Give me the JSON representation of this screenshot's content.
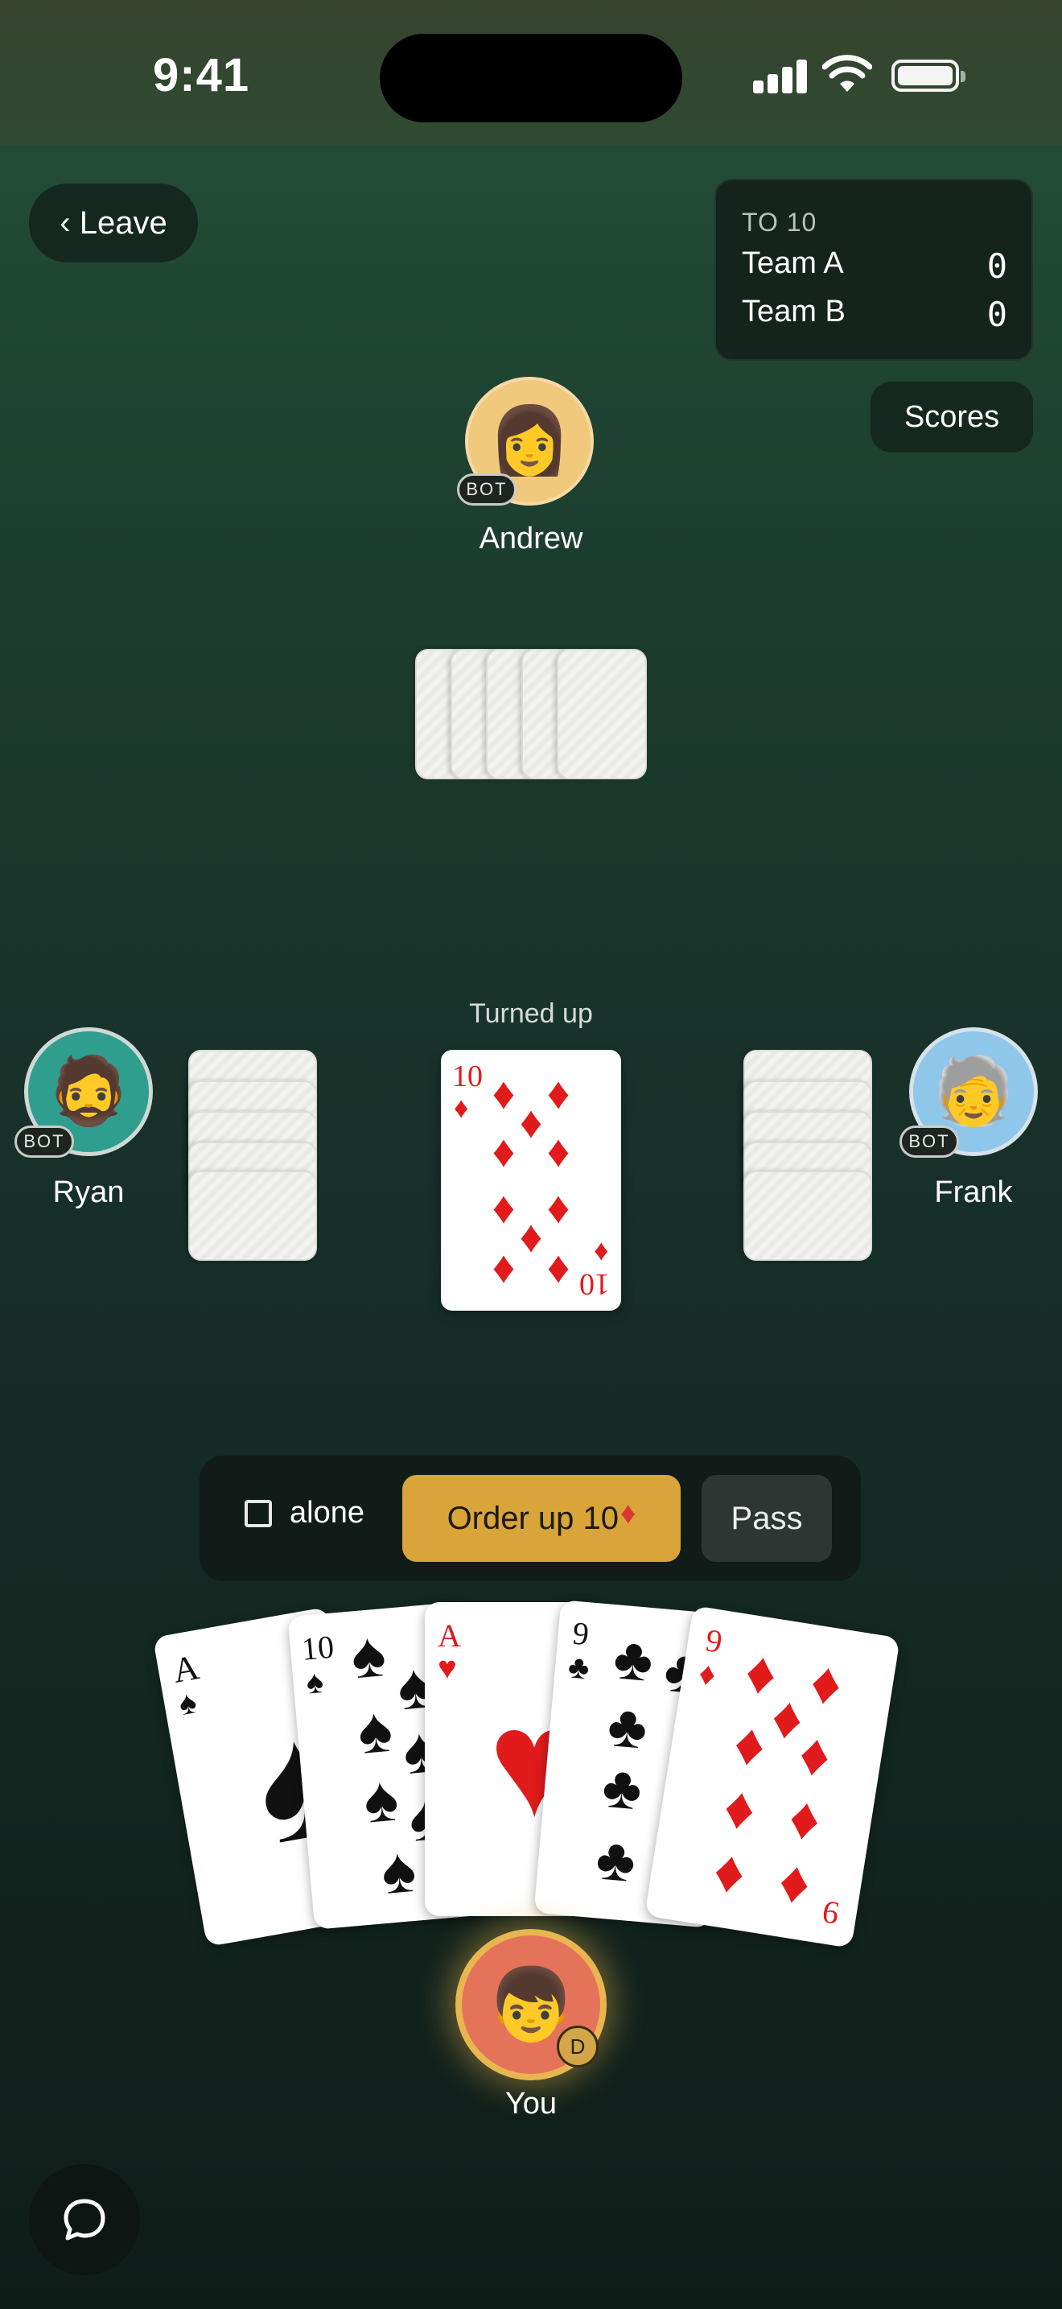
{
  "status_bar": {
    "time": "9:41"
  },
  "header": {
    "leave_label": "‹ Leave",
    "scores_label": "Scores"
  },
  "scoreboard": {
    "title": "TO 10",
    "teams": [
      {
        "name": "Team A",
        "score": "0"
      },
      {
        "name": "Team B",
        "score": "0"
      }
    ]
  },
  "players": {
    "north": {
      "name": "Andrew",
      "badge": "BOT",
      "avatar": "👩"
    },
    "west": {
      "name": "Ryan",
      "badge": "BOT",
      "avatar": "🧔"
    },
    "east": {
      "name": "Frank",
      "badge": "BOT",
      "avatar": "🧓"
    },
    "south": {
      "name": "You",
      "dealer_badge": "D",
      "avatar": "👦"
    }
  },
  "table": {
    "turned_up_label": "Turned up",
    "turned_up_card": {
      "rank": "10",
      "suit": "♦"
    }
  },
  "actions": {
    "alone_label": "alone",
    "order_up_label": "Order up 10",
    "order_up_suit": "♦",
    "pass_label": "Pass"
  },
  "hand": [
    {
      "rank": "A",
      "suit": "♠"
    },
    {
      "rank": "10",
      "suit": "♠"
    },
    {
      "rank": "A",
      "suit": "♥"
    },
    {
      "rank": "9",
      "suit": "♣"
    },
    {
      "rank": "9",
      "suit": "♦"
    }
  ],
  "icons": [
    "chat-bubble-icon",
    "signal-icon",
    "wifi-icon",
    "battery-icon"
  ],
  "colors": {
    "felt": "#1c3d2e",
    "accent_gold": "#d9a53b",
    "red_suit": "#e11b1b"
  }
}
